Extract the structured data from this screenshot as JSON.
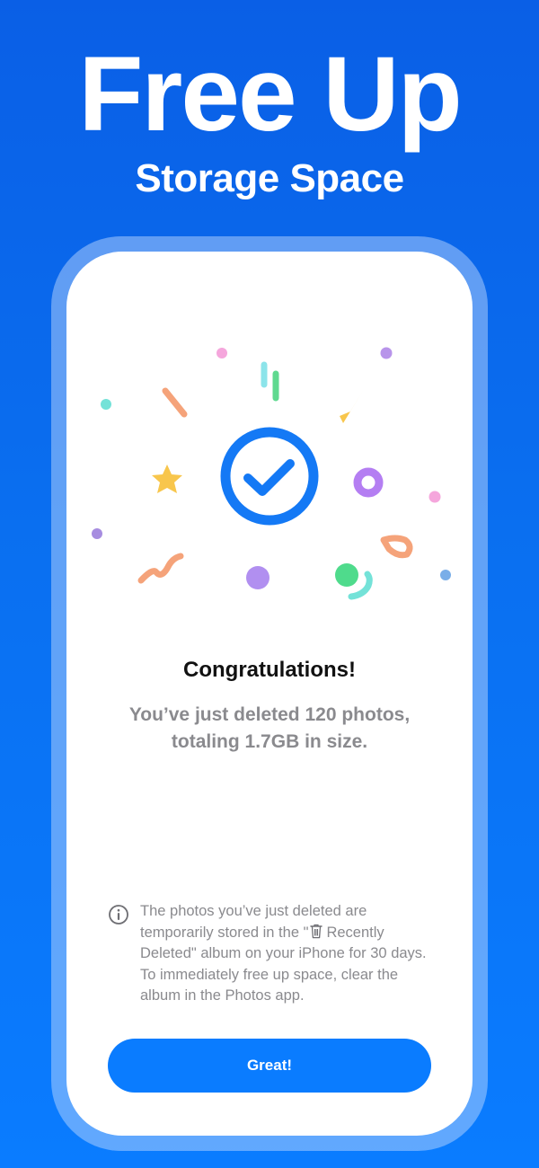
{
  "hero": {
    "title": "Free Up",
    "subtitle": "Storage Space"
  },
  "dialog": {
    "title": "Congratulations!",
    "summary_line1": "You’ve just deleted 120 photos,",
    "summary_line2": "totaling 1.7GB in size.",
    "info": {
      "part1": "The photos you’ve just deleted are temporarily stored in the \"",
      "album_name": "Recently Deleted",
      "part2": "\" album on your iPhone for 30 days. To immediately free up space, clear the album in the Photos app."
    },
    "button_label": "Great!"
  },
  "icons": {
    "check": "checkmark-circle-icon",
    "info": "info-circle-icon",
    "trash": "trash-icon"
  },
  "colors": {
    "background": "#0a6ff0",
    "accent": "#0a7cff",
    "check_ring": "#1479f5",
    "muted_text": "#8a8a8e"
  }
}
